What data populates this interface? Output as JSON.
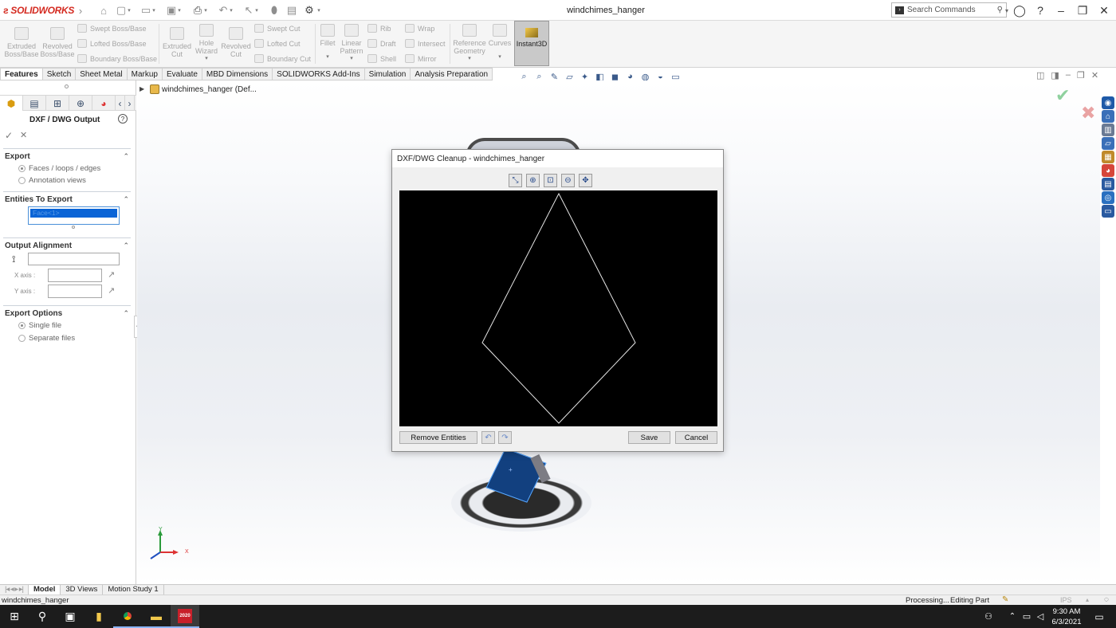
{
  "app": {
    "logo_text": "SOLIDWORKS",
    "document_title": "windchimes_hanger",
    "search_placeholder": "Search Commands",
    "accent": "#d42a20"
  },
  "ribbon": {
    "extruded_boss": "Extruded Boss/Base",
    "revolved_boss": "Revolved Boss/Base",
    "swept_boss": "Swept Boss/Base",
    "lofted_boss": "Lofted Boss/Base",
    "boundary_boss": "Boundary Boss/Base",
    "extruded_cut": "Extruded Cut",
    "hole_wizard": "Hole Wizard",
    "revolved_cut": "Revolved Cut",
    "swept_cut": "Swept Cut",
    "lofted_cut": "Lofted Cut",
    "boundary_cut": "Boundary Cut",
    "fillet": "Fillet",
    "linear_pattern": "Linear Pattern",
    "rib": "Rib",
    "draft": "Draft",
    "shell": "Shell",
    "wrap": "Wrap",
    "intersect": "Intersect",
    "mirror": "Mirror",
    "reference_geometry": "Reference Geometry",
    "curves": "Curves",
    "instant3d": "Instant3D"
  },
  "tabs": [
    "Features",
    "Sketch",
    "Sheet Metal",
    "Markup",
    "Evaluate",
    "MBD Dimensions",
    "SOLIDWORKS Add-Ins",
    "Simulation",
    "Analysis Preparation"
  ],
  "tree": {
    "root_label": "windchimes_hanger  (Def..."
  },
  "property_manager": {
    "title": "DXF / DWG Output",
    "export_header": "Export",
    "export_options": [
      "Faces / loops / edges",
      "Annotation views"
    ],
    "entities_header": "Entities To Export",
    "entities_selected": "Face<1>",
    "alignment_header": "Output Alignment",
    "x_axis_label": "X axis :",
    "y_axis_label": "Y axis :",
    "export_options_header": "Export Options",
    "file_options": [
      "Single file",
      "Separate files"
    ]
  },
  "dialog": {
    "title": "DXF/DWG Cleanup - windchimes_hanger",
    "remove_entities": "Remove Entities",
    "save": "Save",
    "cancel": "Cancel"
  },
  "bottom_tabs": [
    "Model",
    "3D Views",
    "Motion Study 1"
  ],
  "status": {
    "document": "windchimes_hanger",
    "processing": "Processing...",
    "mode": "Editing Part",
    "units": "IPS"
  },
  "taskbar": {
    "time": "9:30 AM",
    "date": "6/3/2021",
    "sw_badge": "2020"
  }
}
